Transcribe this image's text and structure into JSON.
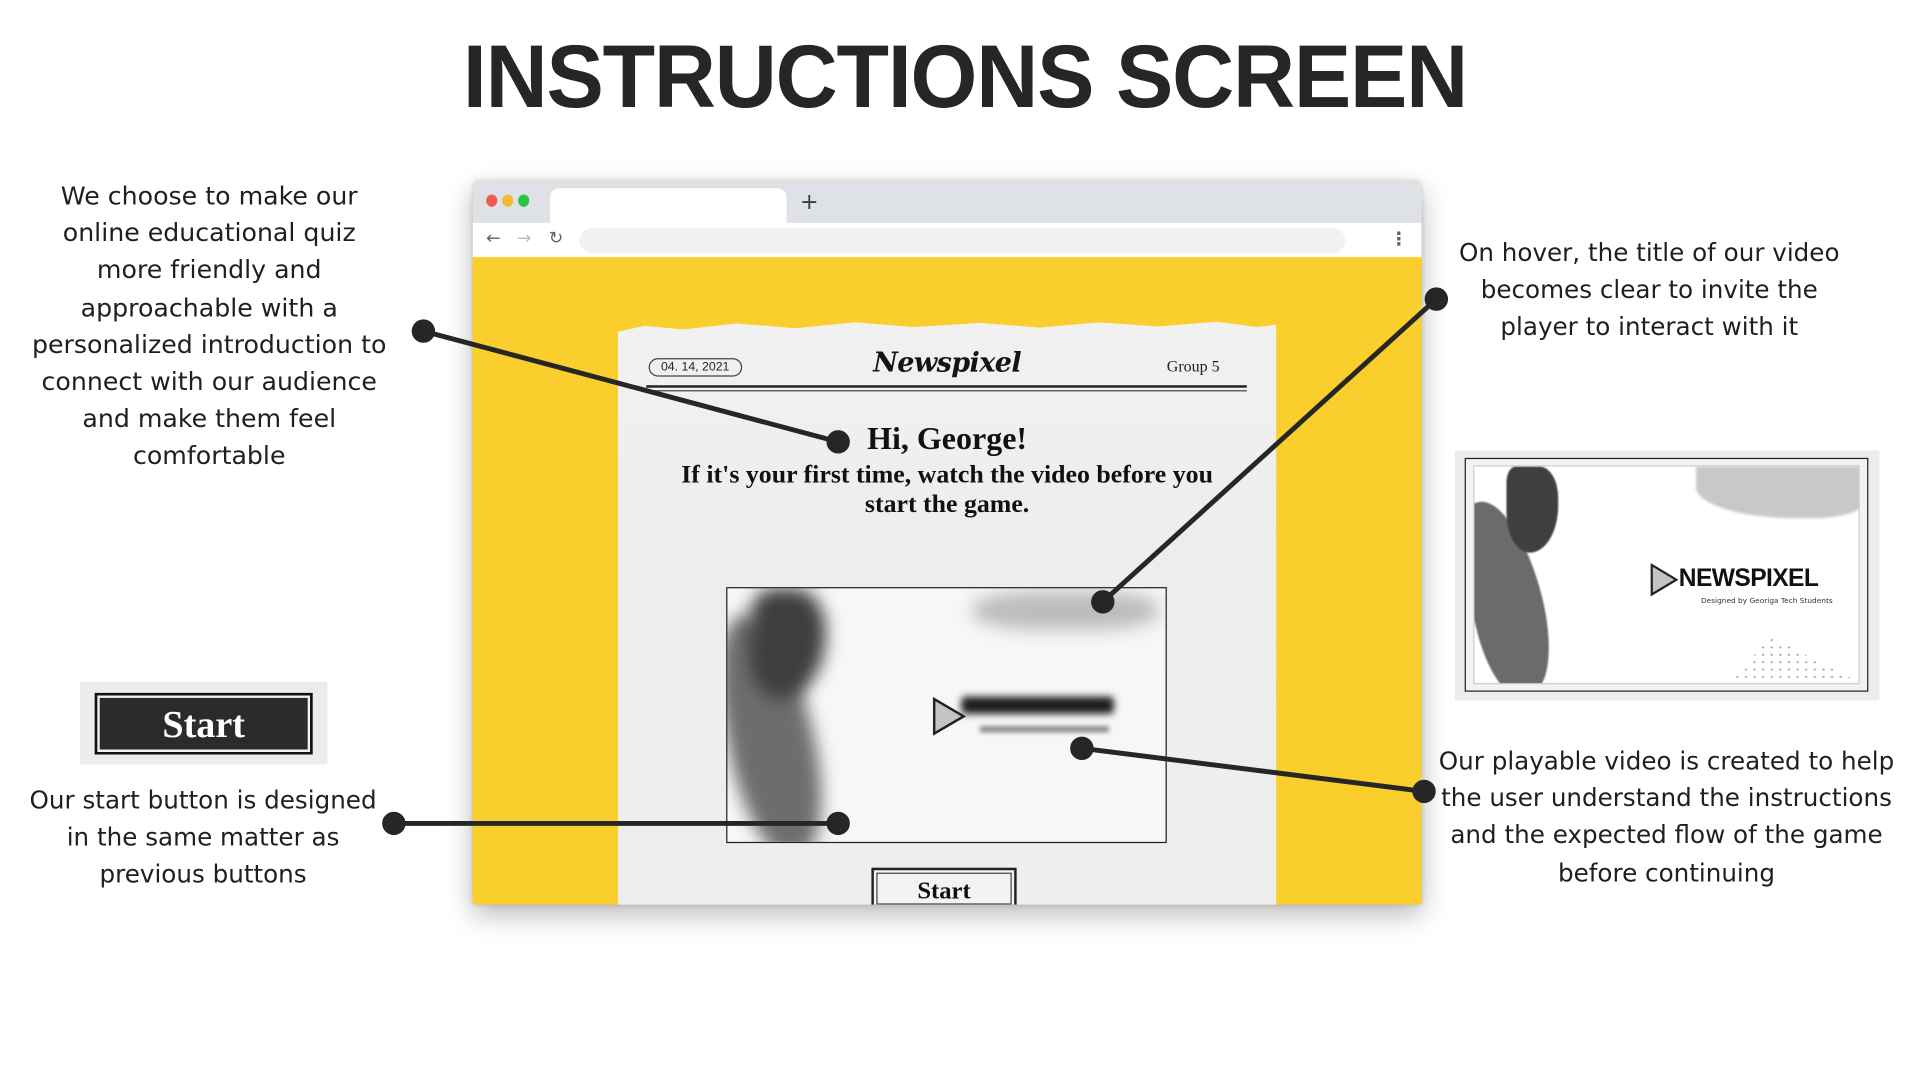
{
  "page": {
    "title": "INSTRUCTIONS SCREEN"
  },
  "annotations": {
    "intro": "We choose to make our\nonline educational quiz\nmore friendly and\napproachable with a\npersonalized introduction to\nconnect with our audience\nand make them feel\ncomfortable",
    "start_button": "Our start button is designed\nin the same matter as\nprevious buttons",
    "hover": "On hover, the title of our video\nbecomes clear to invite the\nplayer to interact with it",
    "video": "Our playable video is created to help\nthe user understand the instructions\nand the expected flow of the game\nbefore continuing"
  },
  "browser": {
    "new_tab_icon": "plus-icon",
    "nav_back_icon": "arrow-left-icon",
    "nav_forward_icon": "arrow-right-icon",
    "reload_icon": "reload-icon",
    "menu_icon": "kebab-menu-icon",
    "url_value": ""
  },
  "newspaper": {
    "date": "04. 14, 2021",
    "masthead": "Newspixel",
    "group": "Group 5",
    "greeting": "Hi, George!",
    "subtitle": "If it's your first time, watch the video before you start the game.",
    "start_label": "Start",
    "video_title_blurred": "NEWSPIXEL"
  },
  "start_sample": {
    "label": "Start"
  },
  "thumbnail": {
    "logo": "NEWSPIXEL",
    "caption": "Designed by Georiga Tech Students"
  },
  "colors": {
    "background_yellow": "#f9ce2d",
    "paper": "#eeeeee",
    "ink": "#1e1e1e",
    "button_dark": "#2b2b2b"
  }
}
